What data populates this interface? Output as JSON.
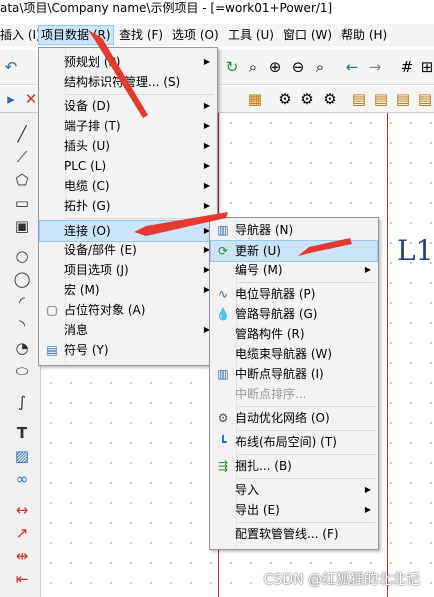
{
  "window": {
    "title": "ata\\项目\\Company name\\示例项目 - [=work01+Power/1]"
  },
  "menubar": {
    "items": [
      {
        "label": "插入 (I)"
      },
      {
        "label": "项目数据 (R)"
      },
      {
        "label": "查找 (F)"
      },
      {
        "label": "选项 (O)"
      },
      {
        "label": "工具 (U)"
      },
      {
        "label": "窗口 (W)"
      },
      {
        "label": "帮助 (H)"
      }
    ]
  },
  "canvas": {
    "label": "L1"
  },
  "menu_project_data": {
    "items": [
      {
        "label": "预规划 (P)",
        "submenu": true
      },
      {
        "label": "结构标识符管理... (S)",
        "submenu": false
      },
      {
        "label": "设备 (D)",
        "submenu": true
      },
      {
        "label": "端子排 (T)",
        "submenu": true
      },
      {
        "label": "插头 (U)",
        "submenu": true
      },
      {
        "label": "PLC (L)",
        "submenu": true
      },
      {
        "label": "电缆 (C)",
        "submenu": true
      },
      {
        "label": "拓扑 (G)",
        "submenu": true
      },
      {
        "label": "连接 (O)",
        "submenu": true
      },
      {
        "label": "设备/部件 (E)",
        "submenu": true
      },
      {
        "label": "项目选项 (J)",
        "submenu": true
      },
      {
        "label": "宏 (M)",
        "submenu": true
      },
      {
        "label": "占位符对象 (A)",
        "submenu": false
      },
      {
        "label": "消息",
        "submenu": true
      },
      {
        "label": "符号 (Y)",
        "submenu": false
      }
    ]
  },
  "menu_connection": {
    "items": [
      {
        "label": "导航器 (N)"
      },
      {
        "label": "更新 (U)"
      },
      {
        "label": "编号 (M)"
      },
      {
        "label": "电位导航器 (P)"
      },
      {
        "label": "管路导航器 (G)"
      },
      {
        "label": "管路构件 (R)"
      },
      {
        "label": "电缆束导航器 (W)"
      },
      {
        "label": "中断点导航器 (I)"
      },
      {
        "label": "中断点排序..."
      },
      {
        "label": "自动优化网络 (O)"
      },
      {
        "label": "布线(布局空间) (T)"
      },
      {
        "label": "捆扎... (B)"
      },
      {
        "label": "导入"
      },
      {
        "label": "导出 (E)"
      },
      {
        "label": "配置软管管线... (F)"
      }
    ]
  },
  "watermark": "CSDN @红狐狸的北北记",
  "colors": {
    "highlight": "#cce4f7",
    "highlight_border": "#99c9ef",
    "arrow": "#e53a2f",
    "label": "#2a3b8f"
  }
}
